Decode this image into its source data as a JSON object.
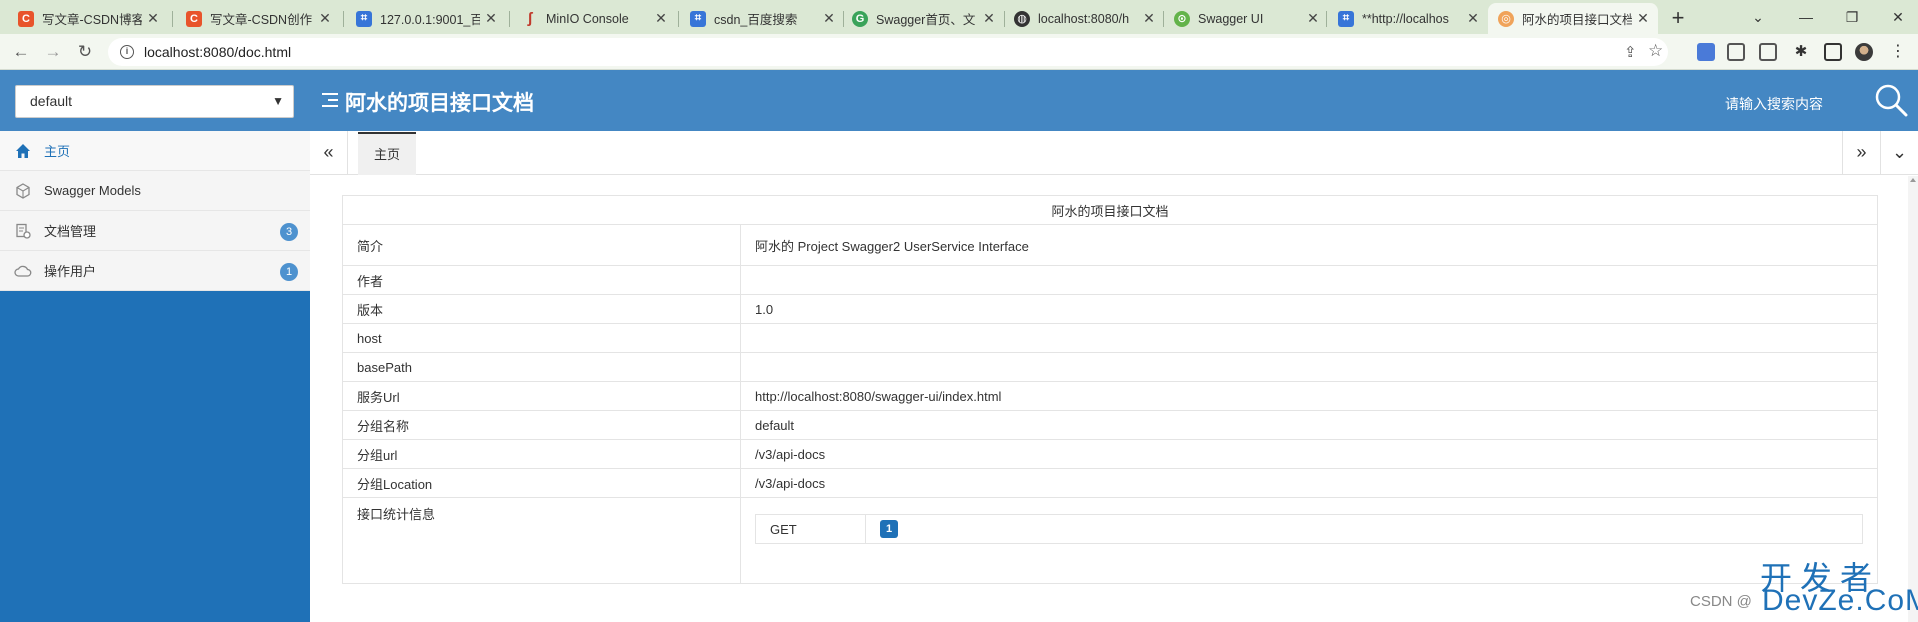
{
  "browser": {
    "tabs": [
      {
        "title": "写文章-CSDN博客",
        "fav_color": "#e8542b",
        "fav_glyph": "C",
        "active": false
      },
      {
        "title": "写文章-CSDN创作",
        "fav_color": "#e8542b",
        "fav_glyph": "C",
        "active": false
      },
      {
        "title": "127.0.0.1:9001_百",
        "fav_color": "#3775d8",
        "fav_glyph": "⌗",
        "active": false
      },
      {
        "title": "MinIO Console",
        "fav_color": "#c0392b",
        "fav_glyph": "ʃ",
        "active": false
      },
      {
        "title": "csdn_百度搜索",
        "fav_color": "#3775d8",
        "fav_glyph": "⌗",
        "active": false
      },
      {
        "title": "Swagger首页、文",
        "fav_color": "#3aa35a",
        "fav_glyph": "G",
        "active": false
      },
      {
        "title": "localhost:8080/h",
        "fav_color": "#333333",
        "fav_glyph": "◍",
        "active": false
      },
      {
        "title": "Swagger UI",
        "fav_color": "#63b34a",
        "fav_glyph": "⊙",
        "active": false
      },
      {
        "title": "**http://localhos",
        "fav_color": "#3775d8",
        "fav_glyph": "⌗",
        "active": false
      },
      {
        "title": "阿水的项目接口文档",
        "fav_color": "#f0a35a",
        "fav_glyph": "◎",
        "active": true
      }
    ],
    "new_tab_glyph": "+",
    "window_controls": [
      "⌄",
      "—",
      "❐",
      "✕"
    ],
    "url": "localhost:8080/doc.html"
  },
  "header": {
    "group_select_value": "default",
    "title": "阿水的项目接口文档",
    "search_placeholder": "请输入搜索内容"
  },
  "sidebar": {
    "items": [
      {
        "label": "主页",
        "icon": "home-icon",
        "badge": null,
        "active": true
      },
      {
        "label": "Swagger Models",
        "icon": "models-icon",
        "badge": null,
        "active": false
      },
      {
        "label": "文档管理",
        "icon": "doc-manage-icon",
        "badge": "3",
        "active": false
      },
      {
        "label": "操作用户",
        "icon": "cloud-icon",
        "badge": "1",
        "active": false
      }
    ]
  },
  "tabbar": {
    "collapse_left": "«",
    "page_tab": "主页",
    "expand_right": "»",
    "more": "⌄"
  },
  "doc": {
    "caption": "阿水的项目接口文档",
    "rows": [
      {
        "key": "简介",
        "value": "阿水的 Project Swagger2 UserService Interface"
      },
      {
        "key": "作者",
        "value": ""
      },
      {
        "key": "版本",
        "value": "1.0"
      },
      {
        "key": "host",
        "value": ""
      },
      {
        "key": "basePath",
        "value": ""
      },
      {
        "key": "服务Url",
        "value": "http://localhost:8080/swagger-ui/index.html"
      },
      {
        "key": "分组名称",
        "value": "default"
      },
      {
        "key": "分组url",
        "value": "/v3/api-docs"
      },
      {
        "key": "分组Location",
        "value": "/v3/api-docs"
      }
    ],
    "stats_label": "接口统计信息",
    "stats": [
      {
        "method": "GET",
        "count": "1"
      }
    ]
  },
  "watermark": {
    "big": "开发者",
    "small": "CSDN @",
    "devze": "DevZe.CoM"
  }
}
